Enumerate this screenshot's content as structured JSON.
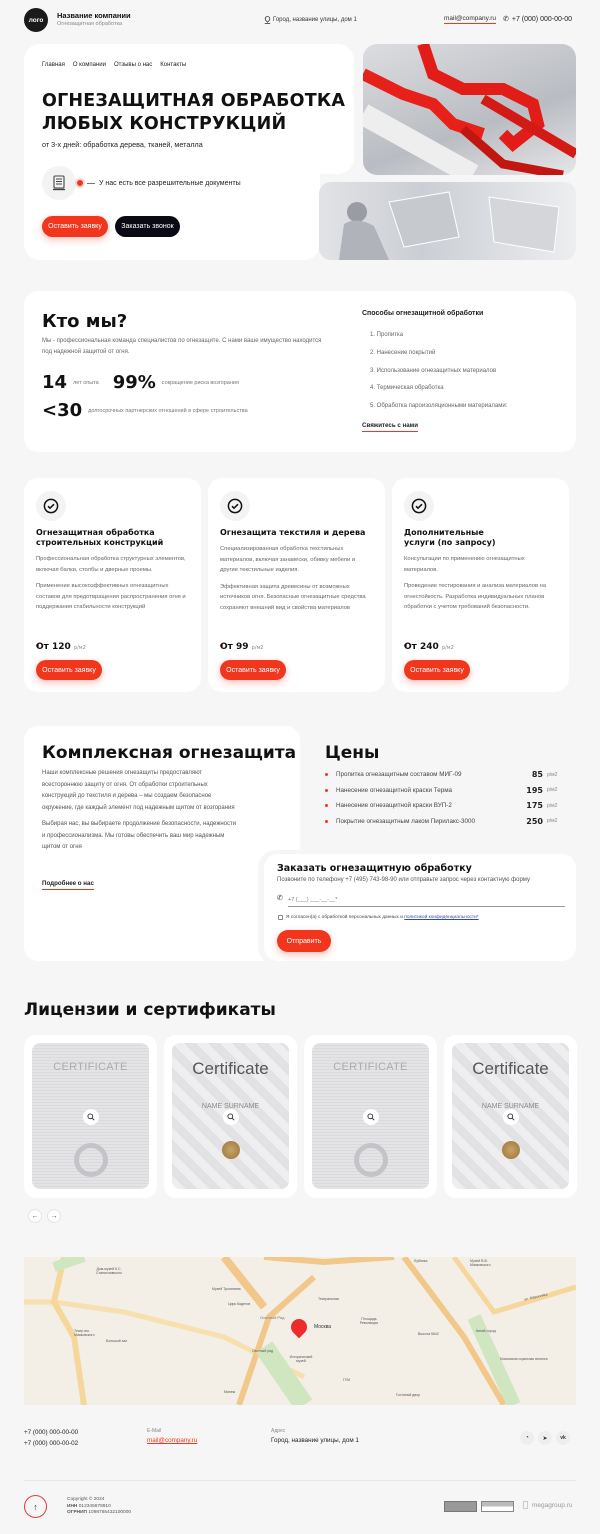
{
  "header": {
    "logo": "лого",
    "company_name": "Название компании",
    "company_sub": "Огнезащитная обработка",
    "address": "Город, название улицы, дом 1",
    "email": "mail@company.ru",
    "phone": "+7 (000) 000-00-00"
  },
  "hero": {
    "nav": [
      "Главная",
      "О компании",
      "Отзывы о нас",
      "Контакты"
    ],
    "title_line1": "ОГНЕЗАЩИТНАЯ ОБРАБОТКА",
    "title_line2": "ЛЮБЫХ КОНСТРУКЦИЙ",
    "subtitle": "от 3-х дней: обработка дерева, тканей, металла",
    "feature": "У нас есть все разрешительные документы",
    "btn_request": "Оставить заявку",
    "btn_call": "Заказать звонок"
  },
  "about": {
    "title": "Кто мы?",
    "text": "Мы - профессиональная команда специалистов по огнезащите. С нами ваше имущество находится под надежной защитой от огня.",
    "stats": [
      {
        "value": "14",
        "label": "лет опыта"
      },
      {
        "value": "99%",
        "label": "сокращение риска возгорания"
      },
      {
        "value": "<30",
        "label": "долгосрочных партнерских отношений в сфере строительства"
      }
    ],
    "methods_title": "Способы огнезащитной обработки",
    "methods": [
      "1. Пропитка",
      "2. Нанесение покрытий",
      "3. Использование огнезащитных материалов",
      "4. Термическая обработка",
      "5. Обработка пароизоляционными материалами:"
    ],
    "contact_link": "Свяжитесь с нами"
  },
  "services": [
    {
      "title": "Огнезащитная обработка строительных конструкций",
      "p1": "Профессиональная обработка структурных элементов, включая балки, столбы и дверные проемы.",
      "p2": "Применение высокоэффективных огнезащитных составов для предотвращения распространения огня и поддержания стабильности конструкций",
      "price": "От 120",
      "unit": "р/м2",
      "button": "Оставить заявку"
    },
    {
      "title": "Огнезащита текстиля и дерева",
      "p1": "Специализированная обработка текстильных материалов, включая занавески, обивку мебели и другие текстильные изделия.",
      "p2": "Эффективная защита древесины от возможных источников огня. Безопасные огнезащитные средства сохраняют внешний вид и свойства материалов",
      "price": "От 99",
      "unit": "р/м2",
      "button": "Оставить заявку"
    },
    {
      "title": "Дополнительные услуги (по запросу)",
      "p1": "Консультации по применению огнезащитных материалов.",
      "p2": "Проведение тестирования и анализа материалов на огнестойкость. Разработка индивидуальных планов обработки с учетом требований безопасности.",
      "price": "От 240",
      "unit": "р/м2",
      "button": "Оставить заявку"
    }
  ],
  "complex": {
    "title": "Комплексная огнезащита",
    "p1": "Наши комплексные решения огнезащиты предоставляют всестороннюю защиту от огня. От обработки строительных конструкций до текстиля и дерева – мы создаем безопасное окружение, где каждый элемент под надежным щитом от возгорания",
    "p2": "Выбирая нас, вы выбираете продолжение безопасности, надежности и профессионализма. Мы готовы обеспечить ваш мир надежным щитом от огня",
    "link": "Подробнее о нас"
  },
  "prices": {
    "title": "Цены",
    "items": [
      {
        "name": "Пропитка огнезащитным составом МИГ-09",
        "value": "85",
        "unit": "р/м2"
      },
      {
        "name": "Нанесение огнезащитной краски Терма",
        "value": "195",
        "unit": "р/м2"
      },
      {
        "name": "Нанесение огнезащитной краски  ВУП-2",
        "value": "175",
        "unit": "р/м2"
      },
      {
        "name": "Покрытие огнезащитным лаком Пирилакс-3000",
        "value": "250",
        "unit": "р/м2"
      }
    ]
  },
  "form": {
    "title": "Заказать огнезащитную обработку",
    "subtitle": "Позвоните по телефону +7 (495) 743-98-90 или отправьте запрос через контактную форму",
    "phone_placeholder": "+7 (___) ___-__-__*",
    "consent_text": "Я согласен(а) с обработкой персональных данных и ",
    "consent_link": "политикой конфиденциальности*",
    "submit": "Отправить"
  },
  "licenses": {
    "title": "Лицензии и сертификаты",
    "items": [
      {
        "label": "CERTIFICATE"
      },
      {
        "label": "Certificate",
        "name": "NAME SURNAME"
      },
      {
        "label": "CERTIFICATE"
      },
      {
        "label": "Certificate",
        "name": "NAME SURNAME"
      }
    ]
  },
  "map": {
    "labels": [
      "Дом-музей К.С. Станиславского",
      "Театр им. Маяковского",
      "Большой зал",
      "Музей Тропинина",
      "Цирк Кадетов",
      "Охотный Ряд",
      "Охотный ряд",
      "Театральная",
      "Москва",
      "Исторический музей",
      "ГУМ",
      "Площадь Революции",
      "Манеж",
      "Гостиный двор",
      "Высота 5642",
      "Китай-город",
      "ул. Маросейка",
      "Московская хоральная синагога",
      "Лубянка",
      "Музей В.В. Маяковского"
    ]
  },
  "footer": {
    "phone1": "+7 (000) 000-00-00",
    "phone2": "+7 (000) 000-00-02",
    "email_label": "E-Mail",
    "email": "mail@company.ru",
    "address_label": "Адрес",
    "address": "Город, название улицы, дом 1",
    "copyright": "Copyright © 2024",
    "inn_label": "ИНН",
    "inn": "012345678910",
    "ogrnip_label": "ОГРНИП",
    "ogrnip": "1098765432100000",
    "dev": "megagroup.ru"
  },
  "colors": {
    "accent": "#f2361e",
    "dark": "#0a0a14",
    "background": "#f6f6f6"
  }
}
